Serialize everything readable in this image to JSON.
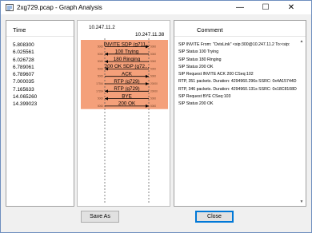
{
  "window": {
    "title": "2xg729.pcap - Graph Analysis",
    "controls": {
      "minimize": "—",
      "maximize": "☐",
      "close": "✕"
    }
  },
  "time_pane": {
    "header": "Time",
    "rows": [
      "5.808300",
      "6.025561",
      "6.026728",
      "6.789061",
      "6.789607",
      "7.000035",
      "7.165633",
      "14.065260",
      "14.399023"
    ]
  },
  "diagram": {
    "host_a": "10.247.11.2",
    "host_b": "10.247.11.38",
    "band_color": "#f4a07a",
    "messages": [
      {
        "label": "INVITE SDP (g711...",
        "dir": "right",
        "port_left": "5060",
        "port_right": "5060"
      },
      {
        "label": "100 Trying",
        "dir": "left",
        "port_left": "5060",
        "port_right": "5060"
      },
      {
        "label": "180 Ringing",
        "dir": "left",
        "port_left": "5060",
        "port_right": "5060"
      },
      {
        "label": "200 OK SDP (g72...",
        "dir": "left",
        "port_left": "5060",
        "port_right": "5060"
      },
      {
        "label": "ACK",
        "dir": "right",
        "port_left": "5060",
        "port_right": "5060"
      },
      {
        "label": "RTP (g729)",
        "dir": "right",
        "port_left": "17354",
        "port_right": "20000"
      },
      {
        "label": "RTP (g729)",
        "dir": "left",
        "port_left": "17354",
        "port_right": "20000"
      },
      {
        "label": "BYE",
        "dir": "left",
        "port_left": "5060",
        "port_right": "5060"
      },
      {
        "label": "200 OK",
        "dir": "right",
        "port_left": "5060",
        "port_right": "5060"
      }
    ]
  },
  "comment_pane": {
    "header": "Comment",
    "rows": [
      "SIP INVITE From: \"OvisLink\" <sip:300@10.247.11.2 To:<sip:",
      "SIP Status 100 Trying",
      "SIP Status 180 Ringing",
      "SIP Status 200 OK",
      "SIP Request INVITE ACK 200 CSeq:102",
      "RTP, 351 packets. Duration: 4294960.296s SSRC: 0x4A15744D",
      "RTP, 346 packets. Duration: 4294960.131s SSRC: 0x18C8108D",
      "SIP Request BYE CSeq:103",
      "SIP Status 200 OK"
    ],
    "scroll_up": "▲",
    "scroll_down": "▼"
  },
  "buttons": {
    "save_as": "Save As",
    "close": "Close"
  }
}
